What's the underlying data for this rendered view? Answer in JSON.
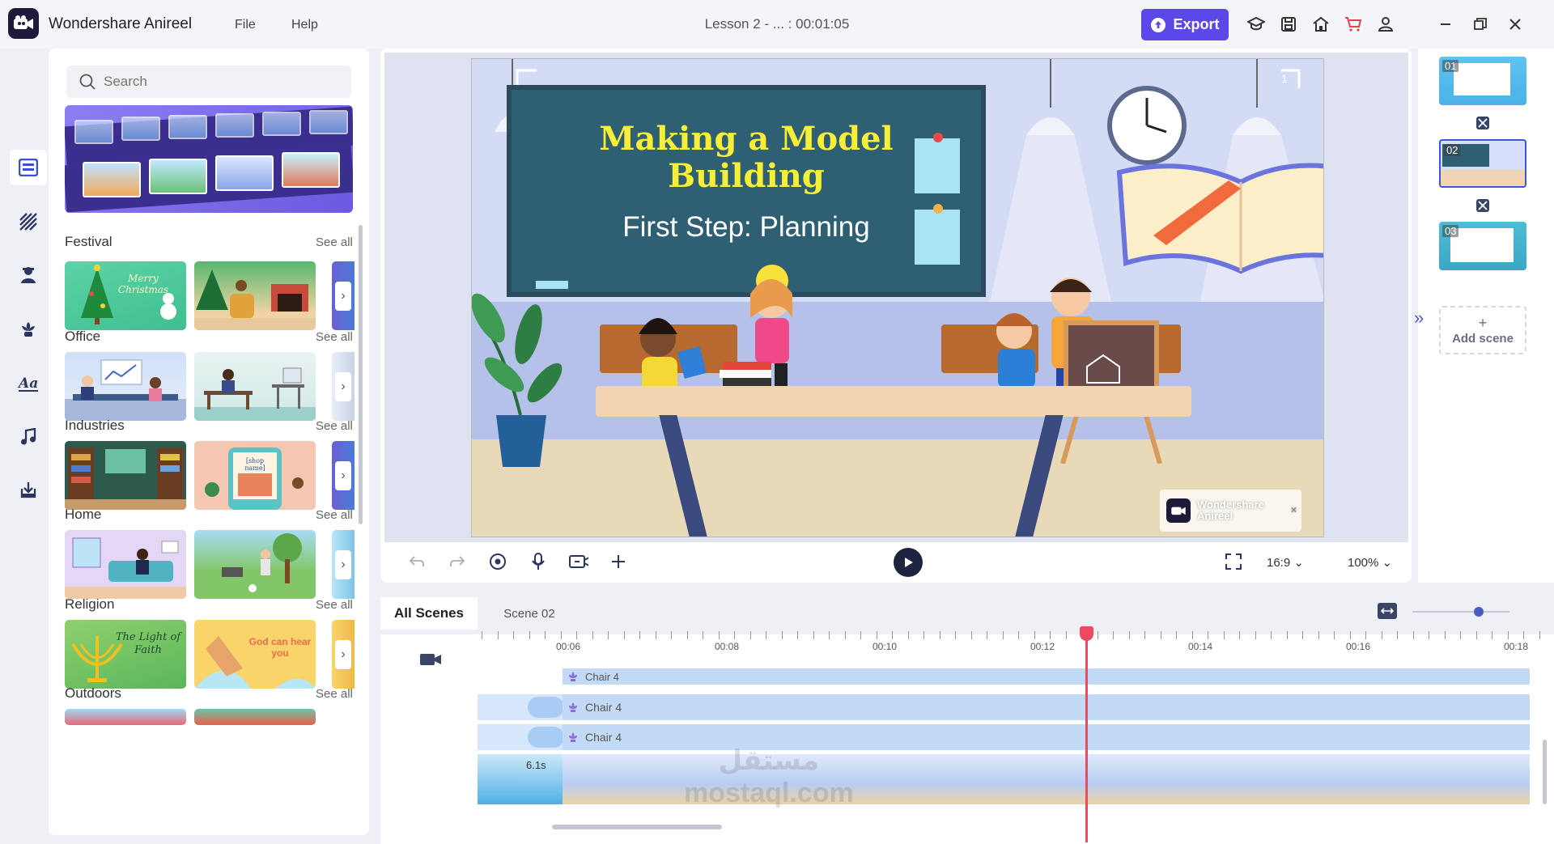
{
  "app": {
    "name": "Wondershare Anireel",
    "document_title": "Lesson 2 - ... : 00:01:05"
  },
  "menu": {
    "file": "File",
    "help": "Help"
  },
  "toolbar": {
    "export_label": "Export"
  },
  "search": {
    "placeholder": "Search"
  },
  "categories": [
    {
      "title": "Festival",
      "see_all": "See all"
    },
    {
      "title": "Office",
      "see_all": "See all"
    },
    {
      "title": "Industries",
      "see_all": "See all"
    },
    {
      "title": "Home",
      "see_all": "See all"
    },
    {
      "title": "Religion",
      "see_all": "See all"
    },
    {
      "title": "Outdoors",
      "see_all": "See all"
    }
  ],
  "thumb_texts": {
    "festival_1": "Merry Christmas",
    "industries_2": "[shop name]",
    "religion_1": "The Light of Faith",
    "religion_2": "God can hear you"
  },
  "canvas": {
    "title_line1": "Making a Model",
    "title_line2": "Building",
    "subtitle": "First Step: Planning",
    "page_marker": "1",
    "watermark_line1": "Wondershare",
    "watermark_line2": "Anireel",
    "watermark_close": "×"
  },
  "canvas_controls": {
    "aspect_ratio": "16:9",
    "zoom": "100%"
  },
  "scenes": {
    "items": [
      {
        "num": "01"
      },
      {
        "num": "02"
      },
      {
        "num": "03"
      }
    ],
    "add_plus": "+",
    "add_label": "Add scene"
  },
  "timeline": {
    "tabs": [
      "All Scenes",
      "Scene 02"
    ],
    "ruler_labels": [
      "00:06",
      "00:08",
      "00:10",
      "00:12",
      "00:14",
      "00:16",
      "00:18"
    ],
    "tracks": [
      {
        "label": "Chair 4"
      },
      {
        "label": "Chair 4"
      },
      {
        "label": "Chair 4"
      }
    ],
    "clip_duration": "6.1s"
  },
  "overlay_watermark": {
    "arabic": "مستقل",
    "latin": "mostaql.com"
  },
  "colors": {
    "accent": "#5b48e8",
    "playhead": "#ee4a5b",
    "chalk_title": "#f7ee38"
  },
  "icons": [
    "app-logo",
    "export-upload-icon",
    "tutorial-icon",
    "save-icon",
    "home-icon",
    "cart-icon",
    "account-icon",
    "minimize-icon",
    "restore-icon",
    "close-icon",
    "search-icon"
  ]
}
